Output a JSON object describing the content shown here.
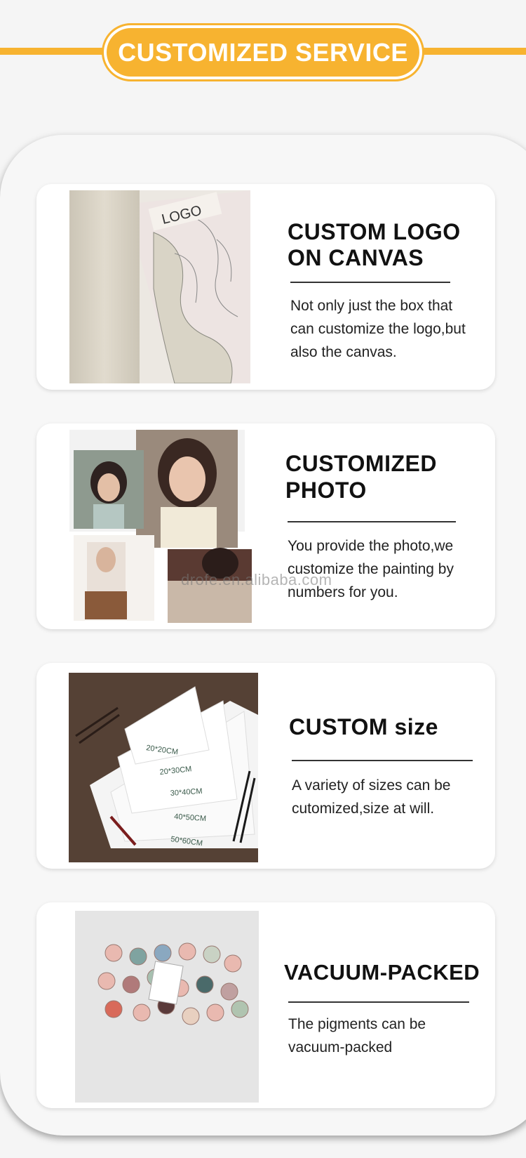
{
  "header": {
    "title": "CUSTOMIZED SERVICE"
  },
  "cards": [
    {
      "title_line1": "CUSTOM LOGO",
      "title_line2": "ON CANVAS",
      "description": "Not only just the box that can customize the logo,but also the canvas.",
      "image_label": "LOGO"
    },
    {
      "title_line1": "CUSTOMIZED",
      "title_line2": "PHOTO",
      "description": "You provide the photo,we customize the painting by numbers for you."
    },
    {
      "title_line1": "CUSTOM size",
      "description": "A variety of sizes can be cutomized,size at will.",
      "size_labels": [
        "20*20CM",
        "20*30CM",
        "30*40CM",
        "40*50CM",
        "50*60CM"
      ]
    },
    {
      "title_line1": "VACUUM-PACKED",
      "description": "The pigments can be vacuum-packed"
    }
  ],
  "watermark": "drofe.en.alibaba.com",
  "colors": {
    "accent": "#f7b330",
    "card_bg": "#ffffff",
    "page_bg": "#f5f5f5"
  }
}
